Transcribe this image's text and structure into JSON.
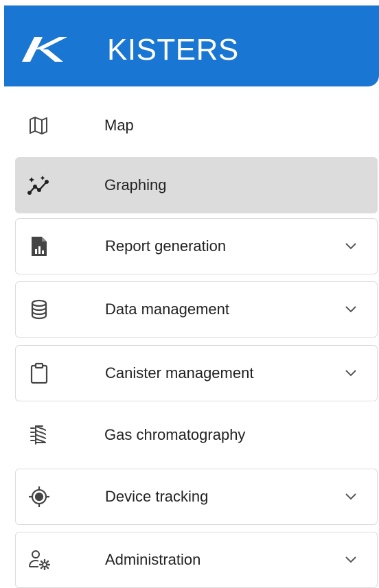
{
  "header": {
    "brand": "KISTERS",
    "color": "#1976d2"
  },
  "nav": {
    "items": [
      {
        "label": "Map",
        "icon": "map-icon",
        "expandable": false,
        "active": false
      },
      {
        "label": "Graphing",
        "icon": "graphing-icon",
        "expandable": false,
        "active": true
      },
      {
        "label": "Report generation",
        "icon": "report-icon",
        "expandable": true,
        "active": false
      },
      {
        "label": "Data management",
        "icon": "database-icon",
        "expandable": true,
        "active": false
      },
      {
        "label": "Canister management",
        "icon": "clipboard-icon",
        "expandable": true,
        "active": false
      },
      {
        "label": "Gas chromatography",
        "icon": "chromatography-icon",
        "expandable": false,
        "active": false
      },
      {
        "label": "Device tracking",
        "icon": "target-icon",
        "expandable": true,
        "active": false
      },
      {
        "label": "Administration",
        "icon": "user-settings-icon",
        "expandable": true,
        "active": false
      }
    ],
    "active_bg": "#dcdcdc",
    "border_color": "#dcdcdc"
  }
}
